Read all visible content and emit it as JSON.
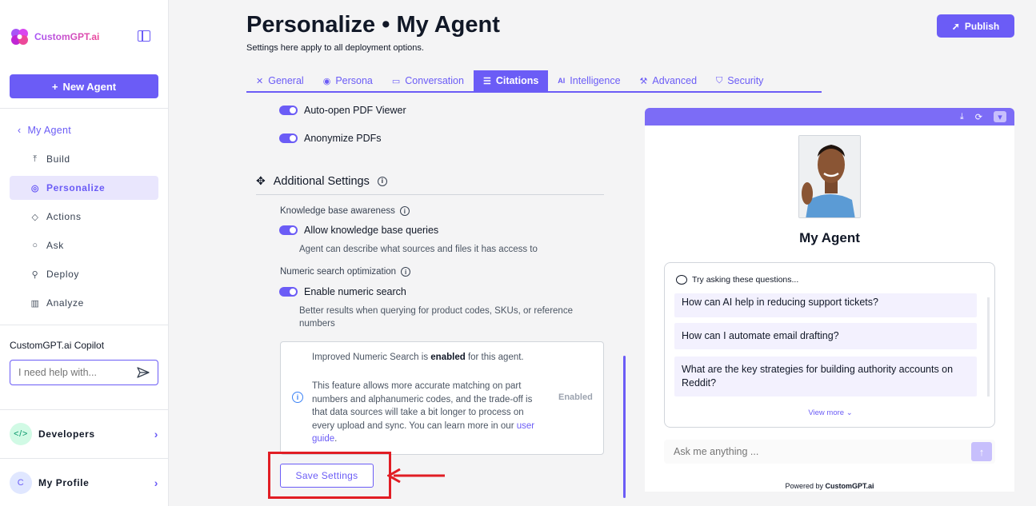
{
  "sidebar": {
    "brand": "CustomGPT.ai",
    "new_agent_label": "New Agent",
    "back_label": "My Agent",
    "items": [
      {
        "label": "Build",
        "icon": "build-icon"
      },
      {
        "label": "Personalize",
        "icon": "palette-icon"
      },
      {
        "label": "Actions",
        "icon": "actions-icon"
      },
      {
        "label": "Ask",
        "icon": "chat-icon"
      },
      {
        "label": "Deploy",
        "icon": "rocket-icon"
      },
      {
        "label": "Analyze",
        "icon": "chart-icon"
      }
    ],
    "copilot_label": "CustomGPT.ai Copilot",
    "copilot_placeholder": "I need help with...",
    "developers_label": "Developers",
    "profile_label": "My Profile",
    "profile_initial": "C"
  },
  "header": {
    "title": "Personalize • My Agent",
    "subtitle": "Settings here apply to all deployment options.",
    "publish_label": "Publish"
  },
  "tabs": [
    {
      "label": "General"
    },
    {
      "label": "Persona"
    },
    {
      "label": "Conversation"
    },
    {
      "label": "Citations"
    },
    {
      "label": "Intelligence"
    },
    {
      "label": "Advanced"
    },
    {
      "label": "Security"
    }
  ],
  "settings": {
    "auto_open_pdf": "Auto-open PDF Viewer",
    "anonymize_pdfs": "Anonymize PDFs",
    "additional_settings": "Additional Settings",
    "kb_awareness_label": "Knowledge base awareness",
    "kb_toggle_label": "Allow knowledge base queries",
    "kb_helper": "Agent can describe what sources and files it has access to",
    "numeric_label": "Numeric search optimization",
    "numeric_toggle_label": "Enable numeric search",
    "numeric_helper": "Better results when querying for product codes, SKUs, or reference numbers",
    "info_line1_pre": "Improved Numeric Search is ",
    "info_line1_bold": "enabled",
    "info_line1_post": " for this agent.",
    "info_para": "This feature allows more accurate matching on part numbers and alphanumeric codes, and the trade-off is that data sources will take a bit longer to process on every upload and sync. You can learn more in our ",
    "info_link": "user guide",
    "info_para_end": ".",
    "info_status": "Enabled",
    "save_label": "Save Settings"
  },
  "preview": {
    "agent_name": "My Agent",
    "suggest_title": "Try asking these questions...",
    "questions": [
      "How can AI help in reducing support tickets?",
      "How can I automate email drafting?",
      "What are the key strategies for building authority accounts on Reddit?"
    ],
    "view_more": "View more",
    "ask_placeholder": "Ask me anything ...",
    "powered_pre": "Powered by ",
    "powered_brand": "CustomGPT.ai"
  },
  "colors": {
    "accent": "#6b5cf6",
    "highlight": "#e11d24"
  }
}
